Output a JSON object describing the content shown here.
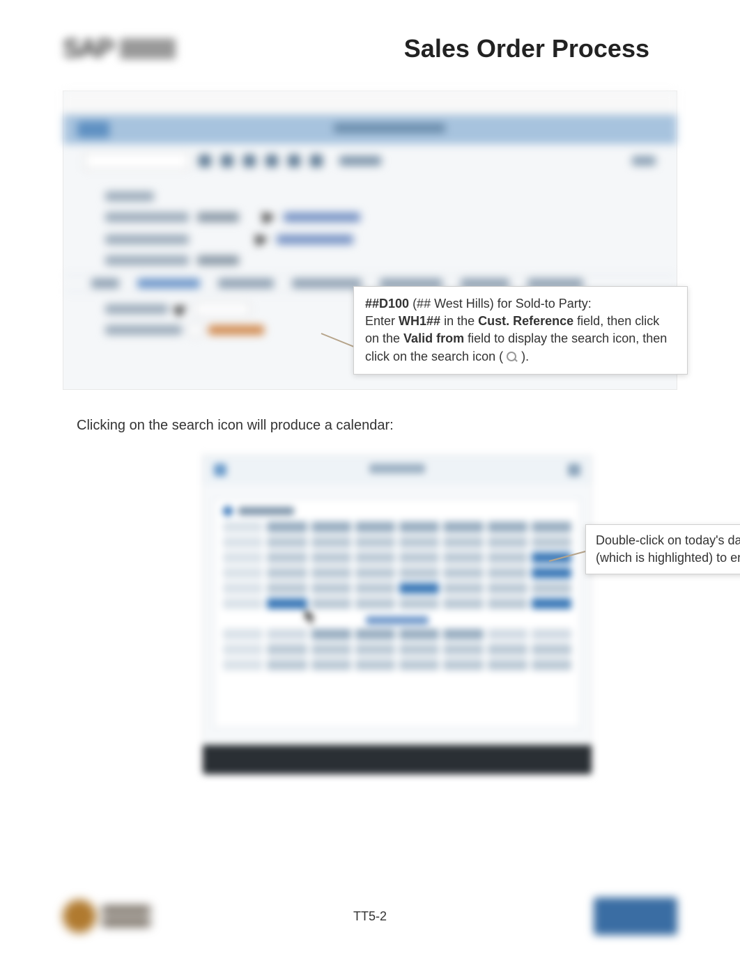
{
  "page_title": "Sales Order Process",
  "callout1": {
    "p1_bold": "##D100",
    "p1_tail": " (## West Hills) for Sold-to Party:",
    "p2_pre": "Enter ",
    "p2_b1": "WH1##",
    "p2_mid": " in the ",
    "p2_b2": "Cust. Reference",
    "p2_tail": " field, then click on the ",
    "p2_b3": "Valid from",
    "p2_end": " field to display the search icon, then click on the search icon (",
    "p2_close": ")."
  },
  "body_text": "Clicking on the search icon will produce a calendar:",
  "callout2_line1": "Double-click on today's date",
  "callout2_line2": "(which is highlighted) to enter it",
  "page_number": "TT5-2"
}
